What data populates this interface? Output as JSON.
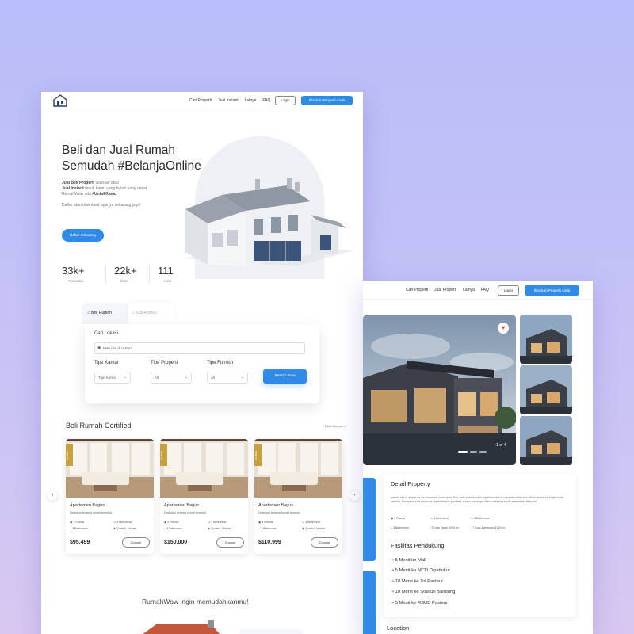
{
  "nav": {
    "links": [
      "Cari Properti",
      "Jual Instant",
      "Lainya",
      "FAQ"
    ],
    "login": "Login",
    "cta": "Iklankan Properti Anda"
  },
  "right_nav": {
    "links": [
      "Cari Properti",
      "Jual Properti",
      "Lainya",
      "FAQ"
    ],
    "login": "Login",
    "cta": "Iklankan Properti Anda"
  },
  "hero": {
    "title_line1": "Beli dan Jual Rumah",
    "title_line2": "Semudah #BelanjaOnline",
    "desc_b1": "Jual Beli Properti",
    "desc_t1": " via iklan atau",
    "desc_b2": "Jual Instant",
    "desc_t2": " untuk kamu yang butuh uang cepat",
    "desc_t3": "RumahWow ada ",
    "desc_b3": "#UntukKamu",
    "note": "Daftar atau download appnya sekarang juga!",
    "cta": "Daftar Sekarang"
  },
  "stats": [
    {
      "num": "33k+",
      "label": "Transaksi"
    },
    {
      "num": "22k+",
      "label": "Iklan"
    },
    {
      "num": "111",
      "label": "User"
    }
  ],
  "search": {
    "tab_active": "Beli Rumah",
    "tab_inactive": "Jual Rumah",
    "location_label": "Cari Lokasi",
    "location_placeholder": "Mau cari di mana?",
    "room_label": "Tipe Kamar",
    "room_value": "Tipe Kamar",
    "property_label": "Tipe Properti",
    "property_value": "All",
    "furnish_label": "Tipe Furnish",
    "furnish_value": "All",
    "button": "Search Now"
  },
  "certified": {
    "title": "Beli Rumah Certified",
    "see_all": "Lihat lainnya",
    "cards": [
      {
        "ribbon": "Certified",
        "name": "Apartemen Bagus",
        "desc": "Deskripsi tentang rumah tersebut",
        "rooms": "3 Rooms",
        "bedrooms": "3 Bedrooms",
        "bathrooms": "3 Bathrooms",
        "location": "Quoted, Jakarta",
        "price": "$95.499",
        "button": "Choose"
      },
      {
        "ribbon": "Certified",
        "name": "Apartemen Bagus",
        "desc": "Deskripsi tentang rumah tersebut",
        "rooms": "3 Rooms",
        "bedrooms": "3 Bedrooms",
        "bathrooms": "3 Bathrooms",
        "location": "Quoted, Jakarta",
        "price": "$150.000",
        "button": "Choose"
      },
      {
        "ribbon": "Certified",
        "name": "Apartemen Bagus",
        "desc": "Deskripsi tentang rumah tersebut",
        "rooms": "3 Rooms",
        "bedrooms": "3 Bedrooms",
        "bathrooms": "3 Bathrooms",
        "location": "Quoted, Jakarta",
        "price": "$110.999",
        "button": "Choose"
      }
    ]
  },
  "help_title": "RumahWow ingin memudahkanmu!",
  "detail": {
    "counter": "1 of 4",
    "title": "Detail Property",
    "text": "natoris nisi ut aliquip ex ea commodo consequat. Duis aute irure dolor in reprehenderit in voluptate velit esse cillum dolore eu fugiat nulla pariatur. Excepteur sint occaecat cupidatat non proident, sunt in culpa qui officia deserunt mollit anim id est laborum.",
    "specs": {
      "rooms": "3 Rooms",
      "bedrooms": "3 Bedrooms",
      "bathrooms_a": "3 Bathrooms",
      "bathrooms_b": "3 Bathrooms",
      "land": "Luas Tanah 1000 m²",
      "building": "Luas Bangunan 1000 m²"
    },
    "facilities_title": "Fasilitas Pendukung",
    "facilities": [
      "5 Menit ke Mall",
      "5 Menit ke MCD Dipatiukur",
      "10 Menit ke Tol Pasteur",
      "10 Menit ke Stasiun Bandung",
      "5 Menit ke RSUD Pasteur"
    ],
    "location_title": "Location"
  },
  "colors": {
    "accent": "#2f8be6",
    "heart": "#e34a4a",
    "ribbon": "#c8a03c"
  }
}
